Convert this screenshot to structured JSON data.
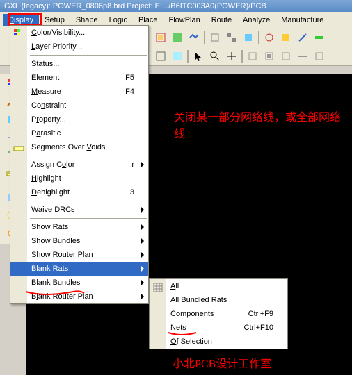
{
  "title": "GXL (legacy): POWER_0806p8.brd  Project: E:.../B6ITC003A0(POWER)/PCB",
  "menubar": [
    "Display",
    "Setup",
    "Shape",
    "Logic",
    "Place",
    "FlowPlan",
    "Route",
    "Analyze",
    "Manufacture"
  ],
  "menu1": {
    "color_visibility": "Color/Visibility...",
    "layer_priority": "Layer Priority...",
    "status": "Status...",
    "element": "Element",
    "element_key": "F5",
    "measure": "Measure",
    "measure_key": "F4",
    "constraint": "Constraint",
    "property": "Property...",
    "parasitic": "Parasitic",
    "segments": "Segments Over Voids",
    "assign_color": "Assign Color",
    "assign_color_key": "r",
    "highlight": "Highlight",
    "dehighlight": "Dehighlight",
    "dehighlight_key": "3",
    "waive_drcs": "Waive DRCs",
    "show_rats": "Show Rats",
    "show_bundles": "Show Bundles",
    "show_router_plan": "Show Router Plan",
    "blank_rats": "Blank Rats",
    "blank_bundles": "Blank Bundles",
    "blank_router_plan": "Blank Router Plan"
  },
  "menu2": {
    "all": "All",
    "all_bundled": "All Bundled Rats",
    "components": "Components",
    "components_key": "Ctrl+F9",
    "nets": "Nets",
    "nets_key": "Ctrl+F10",
    "of_selection": "Of Selection"
  },
  "anno1": "关闭某一部分网络线，或全部网络线",
  "anno2": "小北PCB设计工作室"
}
